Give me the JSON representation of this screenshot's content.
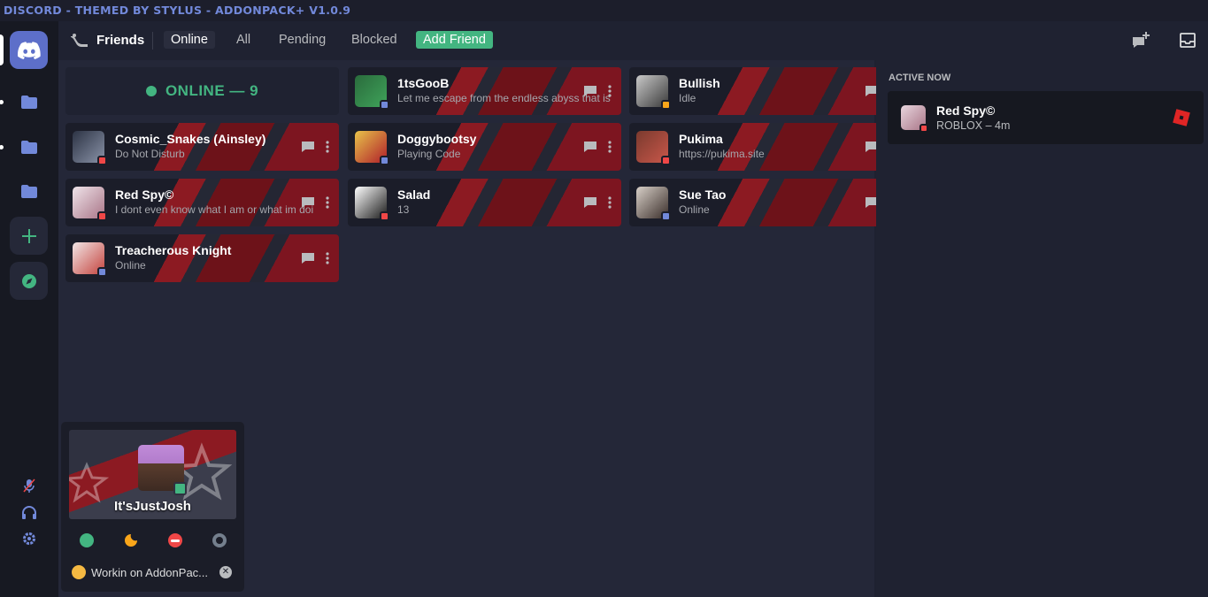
{
  "window": {
    "title": "DISCORD - THEMED BY STYLUS - ADDONPACK+ V1.0.9"
  },
  "topbar": {
    "section_label": "Friends",
    "tabs": [
      {
        "label": "Online",
        "active": true
      },
      {
        "label": "All",
        "active": false
      },
      {
        "label": "Pending",
        "active": false
      },
      {
        "label": "Blocked",
        "active": false
      }
    ],
    "add_friend_label": "Add Friend"
  },
  "friends_list": {
    "header": "ONLINE — 9",
    "friends": [
      {
        "name": "1tsGooB",
        "subtext": "Let me escape from the endless abyss that is",
        "status": "online",
        "status_color": "#7289da",
        "avatar_colors": [
          "#2a6b3c",
          "#3fa35a"
        ]
      },
      {
        "name": "Bullish",
        "subtext": "Idle",
        "status": "idle",
        "status_color": "#faa61a",
        "avatar_colors": [
          "#c9c9c9",
          "#3a3a3a"
        ]
      },
      {
        "name": "Cosmic_Snakes (Ainsley)",
        "subtext": "Do Not Disturb",
        "status": "dnd",
        "status_color": "#f04747",
        "avatar_colors": [
          "#2c3344",
          "#8a93a8"
        ]
      },
      {
        "name": "Doggybootsy",
        "subtext": "Playing Code",
        "status": "online",
        "status_color": "#7289da",
        "avatar_colors": [
          "#e8c34a",
          "#b01f2a"
        ]
      },
      {
        "name": "Pukima",
        "subtext": "https://pukima.site",
        "status": "dnd",
        "status_color": "#f04747",
        "avatar_colors": [
          "#7a3a2e",
          "#c9574a"
        ]
      },
      {
        "name": "Red Spy©",
        "subtext": "I dont even know what I am or what im doi",
        "status": "dnd",
        "status_color": "#f04747",
        "avatar_colors": [
          "#efe4ea",
          "#a97587"
        ]
      },
      {
        "name": "Salad",
        "subtext": "13",
        "status": "dnd",
        "status_color": "#f04747",
        "avatar_colors": [
          "#ffffff",
          "#1a1a1a"
        ]
      },
      {
        "name": "Sue Tao",
        "subtext": "Online",
        "status": "online",
        "status_color": "#7289da",
        "avatar_colors": [
          "#d8d0c8",
          "#3a2e2a"
        ]
      },
      {
        "name": "Treacherous Knight",
        "subtext": "Online",
        "status": "online",
        "status_color": "#7289da",
        "avatar_colors": [
          "#f2e6e6",
          "#c4443e"
        ]
      }
    ]
  },
  "active_now": {
    "title": "ACTIVE NOW",
    "entries": [
      {
        "name": "Red Spy©",
        "activity": "ROBLOX – 4m"
      }
    ]
  },
  "user_popout": {
    "username": "It'sJustJosh",
    "custom_status": "Workin on AddonPac...",
    "status_options": [
      {
        "name": "online",
        "color": "#43b581"
      },
      {
        "name": "idle",
        "color": "#faa61a"
      },
      {
        "name": "dnd",
        "color": "#f04747"
      },
      {
        "name": "invisible",
        "color": "#747f8d"
      }
    ]
  },
  "colors": {
    "accent": "#7289da",
    "online": "#43b581",
    "dnd": "#f04747",
    "idle": "#faa61a"
  }
}
